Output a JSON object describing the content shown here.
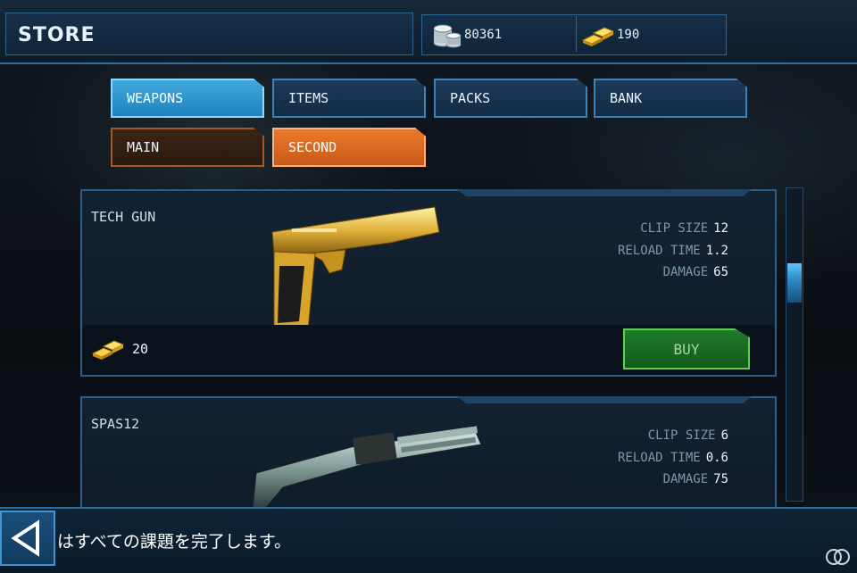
{
  "header": {
    "title": "STORE"
  },
  "currency": {
    "silver": "80361",
    "gold": "190"
  },
  "tabs": [
    {
      "label": "WEAPONS",
      "state": "active"
    },
    {
      "label": "ITEMS",
      "state": "normal"
    },
    {
      "label": "PACKS",
      "state": "normal"
    },
    {
      "label": "BANK",
      "state": "normal"
    }
  ],
  "subtabs": [
    {
      "label": "MAIN",
      "state": "normal"
    },
    {
      "label": "SECOND",
      "state": "active"
    }
  ],
  "items": [
    {
      "name": "TECH GUN",
      "stats": [
        {
          "label": "CLIP SIZE",
          "value": "12"
        },
        {
          "label": "RELOAD TIME",
          "value": "1.2"
        },
        {
          "label": "DAMAGE",
          "value": "65"
        }
      ],
      "price": "20",
      "buy_label": "BUY",
      "icon": "golden-pistol-icon"
    },
    {
      "name": "SPAS12",
      "stats": [
        {
          "label": "CLIP SIZE",
          "value": "6"
        },
        {
          "label": "RELOAD TIME",
          "value": "0.6"
        },
        {
          "label": "DAMAGE",
          "value": "75"
        }
      ],
      "icon": "shotgun-icon"
    }
  ],
  "footer": {
    "subtitle": "はすべての課題を完了します。"
  },
  "colors": {
    "accent_blue": "#3fa8dc",
    "accent_orange": "#ec7a2c",
    "buy_green": "#1f7c2a",
    "gold": "#f3c52b"
  }
}
